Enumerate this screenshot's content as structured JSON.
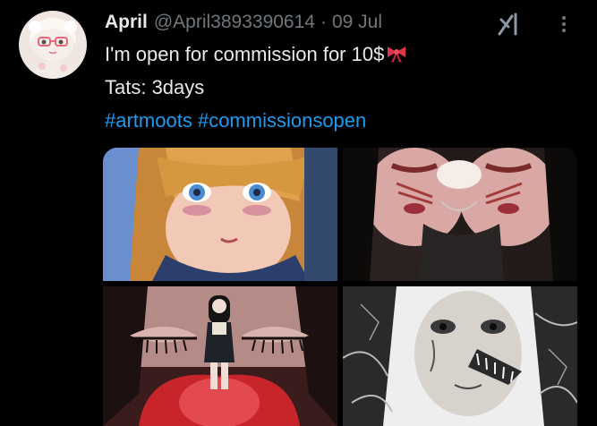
{
  "tweet": {
    "author": {
      "name": "April",
      "handle": "@April3893390614"
    },
    "separator": "·",
    "date": "09 Jul",
    "line1": "I'm open for commission for 10$",
    "line2": "Tats: 3days",
    "hashtags": [
      "#artmoots",
      "#commissionsopen"
    ]
  },
  "icons": {
    "avatar": "avatar-image",
    "grok": "grok-icon",
    "more": "more-options-icon",
    "ribbon": "ribbon-emoji"
  },
  "colors": {
    "background": "#000000",
    "text": "#e7e9ea",
    "muted": "#71767b",
    "link": "#1d9bf0"
  }
}
